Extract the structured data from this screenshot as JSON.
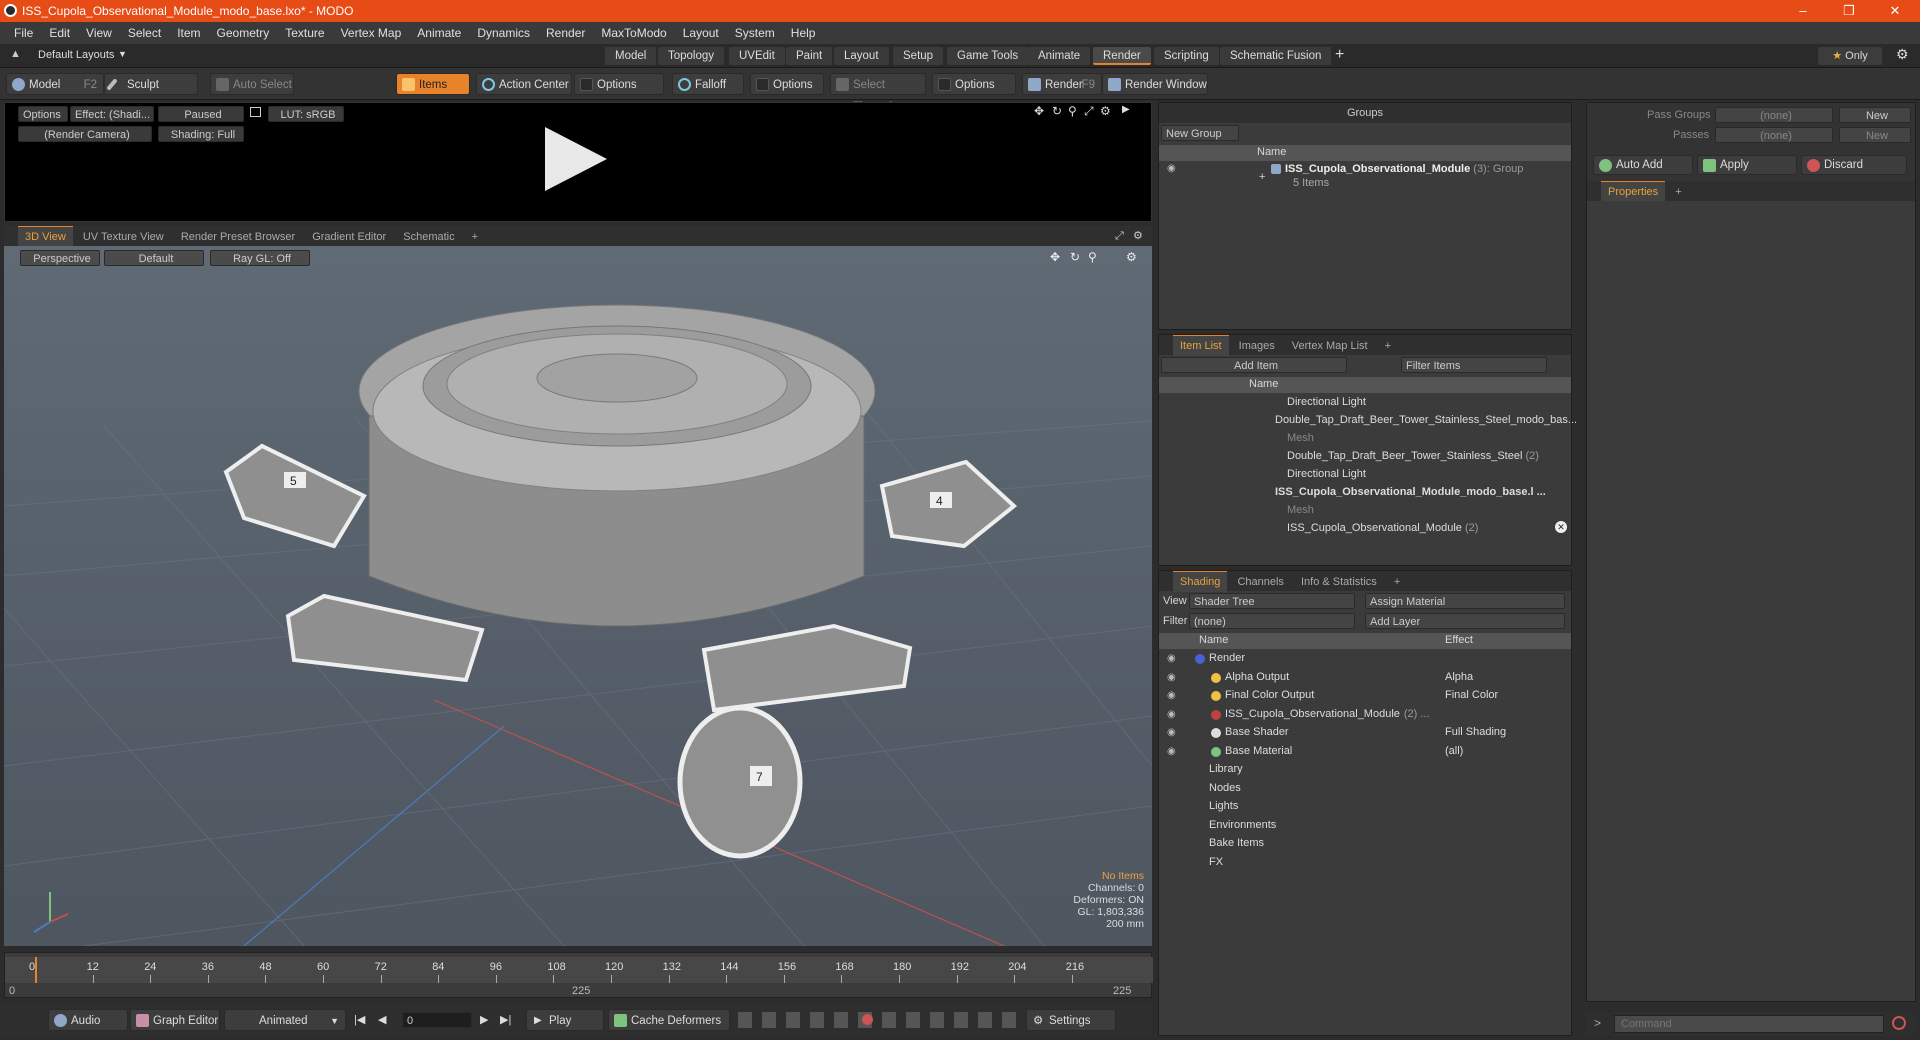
{
  "title": "ISS_Cupola_Observational_Module_modo_base.lxo* - MODO",
  "menu": [
    "File",
    "Edit",
    "View",
    "Select",
    "Item",
    "Geometry",
    "Texture",
    "Vertex Map",
    "Animate",
    "Dynamics",
    "Render",
    "MaxToModo",
    "Layout",
    "System",
    "Help"
  ],
  "layout": {
    "default_layouts": "Default Layouts",
    "tabs": [
      "Model",
      "Topology",
      "UVEdit",
      "Paint",
      "Layout",
      "Setup",
      "Game Tools",
      "Animate",
      "Render",
      "Scripting",
      "Schematic Fusion"
    ],
    "active_tab": "Render",
    "only": "Only"
  },
  "toolbar": {
    "model": "Model",
    "model_key": "F2",
    "sculpt": "Sculpt",
    "auto_select": "Auto Select",
    "items": "Items",
    "action_center": "Action Center",
    "options1": "Options",
    "falloff": "Falloff",
    "options2": "Options",
    "select_through": "Select Through",
    "options3": "Options",
    "render": "Render",
    "render_key": "F9",
    "render_window": "Render Window"
  },
  "preview": {
    "options": "Options",
    "effect": "Effect: (Shadi...",
    "paused": "Paused",
    "lut": "LUT: sRGB",
    "camera": "(Render Camera)",
    "shading": "Shading: Full"
  },
  "viewtabs": [
    "3D View",
    "UV Texture View",
    "Render Preset Browser",
    "Gradient Editor",
    "Schematic"
  ],
  "viewport": {
    "perspective": "Perspective",
    "default": "Default",
    "raygl": "Ray GL: Off",
    "hud": {
      "no_items": "No Items",
      "channels": "Channels: 0",
      "deformers": "Deformers: ON",
      "gl": "GL: 1,803,336",
      "size": "200 mm"
    },
    "module_numbers": [
      "5",
      "4",
      "7"
    ]
  },
  "timeline": {
    "ticks": [
      "0",
      "12",
      "24",
      "36",
      "48",
      "60",
      "72",
      "84",
      "96",
      "108",
      "120",
      "132",
      "144",
      "156",
      "168",
      "180",
      "192",
      "204",
      "216"
    ],
    "sub_ticks": [
      "0",
      "225",
      "225"
    ]
  },
  "bottombar": {
    "audio": "Audio",
    "graph_editor": "Graph Editor",
    "animated": "Animated",
    "frame": "0",
    "play": "Play",
    "cache_deformers": "Cache Deformers",
    "settings": "Settings"
  },
  "groups": {
    "title": "Groups",
    "new_group": "New Group",
    "col_name": "Name",
    "item_name": "ISS_Cupola_Observational_Module",
    "item_count": "(3)",
    "item_type": ": Group",
    "item_sub": "5 Items"
  },
  "itemlist": {
    "tabs": [
      "Item List",
      "Images",
      "Vertex Map List"
    ],
    "add_item": "Add Item",
    "filter": "Filter Items",
    "col_name": "Name",
    "rows": [
      {
        "label": "Directional Light"
      },
      {
        "label": "Double_Tap_Draft_Beer_Tower_Stainless_Steel_modo_bas..."
      },
      {
        "label": "Mesh"
      },
      {
        "label": "Double_Tap_Draft_Beer_Tower_Stainless_Steel",
        "count": "(2)"
      },
      {
        "label": "Directional Light"
      },
      {
        "label": "ISS_Cupola_Observational_Module_modo_base.l ..."
      },
      {
        "label": "Mesh"
      },
      {
        "label": "ISS_Cupola_Observational_Module",
        "count": "(2)"
      }
    ]
  },
  "shading": {
    "tabs": [
      "Shading",
      "Channels",
      "Info & Statistics"
    ],
    "view_label": "View",
    "view_value": "Shader Tree",
    "assign_material": "Assign Material",
    "filter_label": "Filter",
    "filter_value": "(none)",
    "add_layer": "Add Layer",
    "col_name": "Name",
    "col_effect": "Effect",
    "rows": [
      {
        "name": "Render",
        "effect": ""
      },
      {
        "name": "Alpha Output",
        "effect": "Alpha"
      },
      {
        "name": "Final Color Output",
        "effect": "Final Color"
      },
      {
        "name": "ISS_Cupola_Observational_Module",
        "count": "(2) ...",
        "effect": ""
      },
      {
        "name": "Base Shader",
        "effect": "Full Shading"
      },
      {
        "name": "Base Material",
        "effect": "(all)"
      },
      {
        "name": "Library",
        "effect": ""
      },
      {
        "name": "Nodes",
        "effect": ""
      },
      {
        "name": "Lights",
        "effect": ""
      },
      {
        "name": "Environments",
        "effect": ""
      },
      {
        "name": "Bake Items",
        "effect": ""
      },
      {
        "name": "FX",
        "effect": ""
      }
    ]
  },
  "passes": {
    "pass_groups": "Pass Groups",
    "passes": "Passes",
    "none1": "(none)",
    "none2": "(none)",
    "new1": "New",
    "new2": "New",
    "auto_add": "Auto Add",
    "apply": "Apply",
    "discard": "Discard",
    "properties": "Properties"
  },
  "command": {
    "placeholder": "Command"
  },
  "colors": {
    "accent": "#e8832c",
    "titlebar": "#e84c16"
  }
}
